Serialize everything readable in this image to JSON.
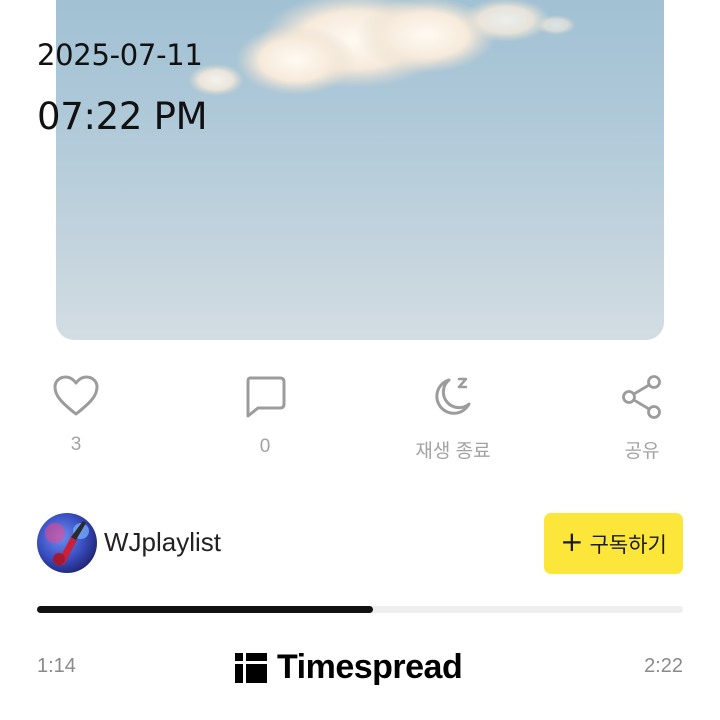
{
  "overlay": {
    "date": "2025-07-11",
    "time": "07:22 PM"
  },
  "actions": {
    "like": {
      "icon": "heart-icon",
      "count": "3"
    },
    "comment": {
      "icon": "speech-bubble-icon",
      "count": "0"
    },
    "sleep_timer": {
      "icon": "moon-zzz-icon",
      "label": "재생 종료"
    },
    "share": {
      "icon": "share-icon",
      "label": "공유"
    }
  },
  "channel": {
    "name": "WJplaylist",
    "subscribe_label": "구독하기",
    "subscribe_color": "#fde63a"
  },
  "player": {
    "elapsed": "1:14",
    "total": "2:22",
    "progress_fraction": 0.52
  },
  "watermark": {
    "text": "Timespread"
  }
}
